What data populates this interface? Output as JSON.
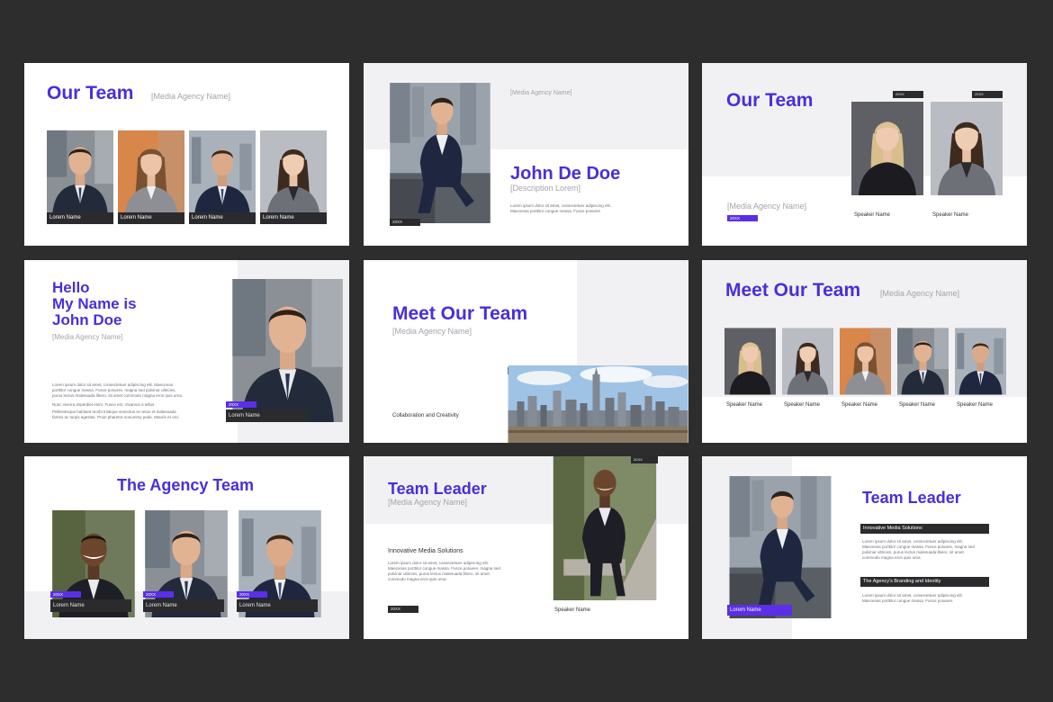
{
  "colors": {
    "accent": "#5b2ee8",
    "title": "#4a2fd9",
    "dark": "#2b2b2d",
    "background": "#2d2d2d",
    "light_panel": "#f1f1f3"
  },
  "slide1": {
    "title": "Our Team",
    "subtitle": "[Media Agency Name]",
    "captions": [
      "Lorem Name",
      "Lorem Name",
      "Lorem Name",
      "Lorem Name"
    ]
  },
  "slide2": {
    "subtitle": "[Media Agency Name]",
    "name": "John De Doe",
    "description": "[Description Lorem]",
    "tag": "20XX",
    "text": "Lorem ipsum dolor sit amet, consectetuer adipiscing elit. Maecenas porttitor congue massa. Fusce posuere"
  },
  "slide3": {
    "title": "Our Team",
    "subtitle": "[Media Agency Name]",
    "tag": "20XX",
    "photo_tags": [
      "20XX",
      "20XX"
    ],
    "speakers": [
      "Speaker Name",
      "Speaker Name"
    ]
  },
  "slide4": {
    "title_lines": [
      "Hello",
      "My Name is",
      "John Doe"
    ],
    "subtitle": "[Media Agency Name]",
    "tag": "20XX",
    "caption": "Lorem Name",
    "text": [
      "Lorem ipsum dolor sit amet, consectetuer adipiscing elit. Maecenas porttitor congue massa. Fusce posuere, magna sed pulvinar ultricies, purus lectus malesuada libero, sit amet commodo magna eros quis urna.",
      "Nunc viverra imperdiet enim. Fusce est. Vivamus a tellus.",
      "Pellentesque habitant morbi tristique senectus et netus et malesuada fames ac turpis egestas. Proin pharetra nonummy pede. Mauris et orci."
    ]
  },
  "slide5": {
    "title": "Meet Our Team",
    "subtitle": "[Media Agency Name]",
    "tag": "20XX",
    "caption": "Collaboration and Creativity"
  },
  "slide6": {
    "title": "Meet Our Team",
    "subtitle": "[Media Agency Name]",
    "speakers": [
      "Speaker Name",
      "Speaker Name",
      "Speaker Name",
      "Speaker Name",
      "Speaker Name"
    ]
  },
  "slide7": {
    "title": "The Agency Team",
    "tags": [
      "20XX",
      "20XX",
      "20XX"
    ],
    "captions": [
      "Lorem Name",
      "Lorem Name",
      "Lorem Name"
    ]
  },
  "slide8": {
    "title": "Team Leader",
    "subtitle": "[Media Agency Name]",
    "heading": "Innovative Media Solutions",
    "text": "Lorem ipsum dolor sit amet, consectetuer adipiscing elit. Maecenas porttitor congue massa. Fusce posuere, magna sed pulvinar ultricies, purus lectus malesuada libero, sit amet commodo magna eros quis urna.",
    "tag": "20XX",
    "photo_tag": "20XX",
    "speaker": "Speaker Name"
  },
  "slide9": {
    "title": "Team Leader",
    "bar1": "Innovative Media Solutions",
    "text1": "Lorem ipsum dolor sit amet, consectetuer adipiscing elit. Maecenas porttitor congue massa. Fusce posuere, magna sed pulvinar ultricies, purus lectus malesuada libero, sit amet commodo magna eros quis urna.",
    "bar2": "The Agency's Branding and Identity",
    "text2": "Lorem ipsum dolor sit amet, consectetuer adipiscing elit. Maecenas porttitor congue massa. Fusce posuere.",
    "caption": "Lorem Name"
  }
}
